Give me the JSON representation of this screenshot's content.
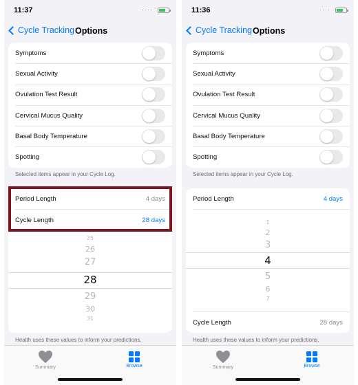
{
  "left": {
    "status_time": "11:37",
    "nav": {
      "back_label": "Cycle Tracking",
      "title": "Options"
    },
    "toggles": [
      {
        "label": "Symptoms"
      },
      {
        "label": "Sexual Activity"
      },
      {
        "label": "Ovulation Test Result"
      },
      {
        "label": "Cervical Mucus Quality"
      },
      {
        "label": "Basal Body Temperature"
      },
      {
        "label": "Spotting"
      }
    ],
    "toggle_note": "Selected items appear in your Cycle Log.",
    "period_length": {
      "label": "Period Length",
      "value": "4 days"
    },
    "cycle_length": {
      "label": "Cycle Length",
      "value": "28 days"
    },
    "picker": {
      "items": [
        "25",
        "26",
        "27",
        "28",
        "29",
        "30",
        "31"
      ],
      "selected": "28"
    },
    "settings_note": "Health uses these values to inform your predictions.",
    "tabs": {
      "summary": "Summary",
      "browse": "Browse"
    }
  },
  "right": {
    "status_time": "11:36",
    "nav": {
      "back_label": "Cycle Tracking",
      "title": "Options"
    },
    "toggles": [
      {
        "label": "Symptoms"
      },
      {
        "label": "Sexual Activity"
      },
      {
        "label": "Ovulation Test Result"
      },
      {
        "label": "Cervical Mucus Quality"
      },
      {
        "label": "Basal Body Temperature"
      },
      {
        "label": "Spotting"
      }
    ],
    "toggle_note": "Selected items appear in your Cycle Log.",
    "period_length": {
      "label": "Period Length",
      "value": "4 days"
    },
    "cycle_length": {
      "label": "Cycle Length",
      "value": "28 days"
    },
    "picker": {
      "items": [
        "1",
        "2",
        "3",
        "4",
        "5",
        "6",
        "7"
      ],
      "selected": "4"
    },
    "settings_note": "Health uses these values to inform your predictions.",
    "tabs": {
      "summary": "Summary",
      "browse": "Browse"
    }
  },
  "colors": {
    "accent": "#007aff",
    "highlight": "#7b1520",
    "battery": "#34c759"
  }
}
